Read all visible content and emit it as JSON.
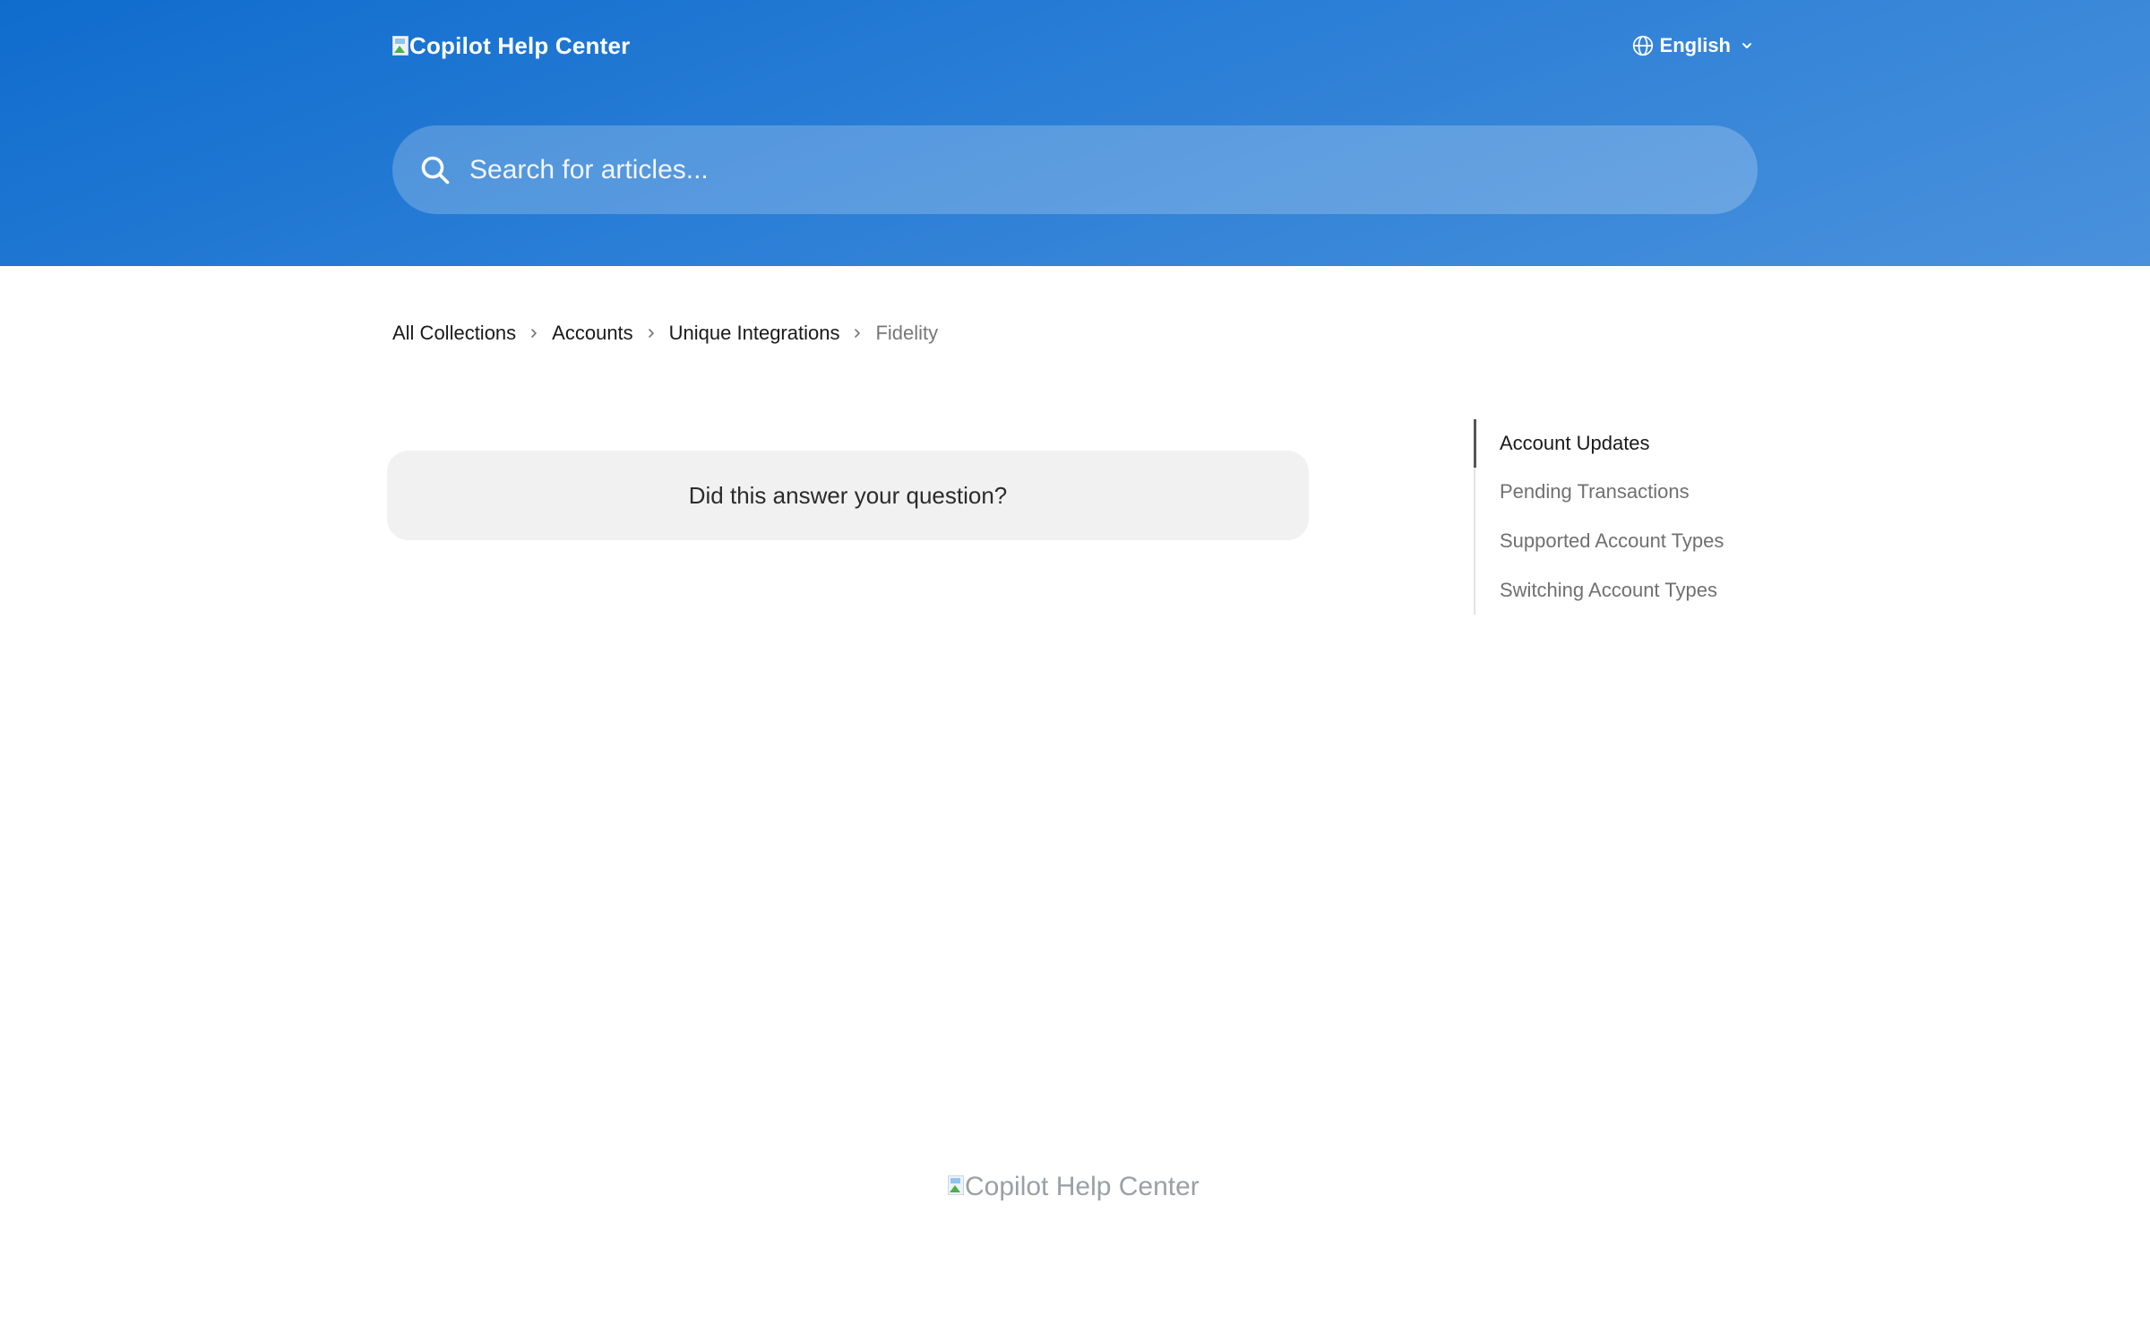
{
  "header": {
    "logo_alt": "Copilot Help Center",
    "language": {
      "label": "English",
      "icon": "globe-icon"
    },
    "search": {
      "placeholder": "Search for articles..."
    },
    "colors": {
      "gradient_start": "#0f6ccd",
      "gradient_end": "#4a91dc"
    }
  },
  "breadcrumb": {
    "items": [
      {
        "label": "All Collections"
      },
      {
        "label": "Accounts"
      },
      {
        "label": "Unique Integrations"
      },
      {
        "label": "Fidelity"
      }
    ]
  },
  "feedback": {
    "question": "Did this answer your question?"
  },
  "toc": {
    "items": [
      {
        "label": "Account Updates",
        "active": true
      },
      {
        "label": "Pending Transactions",
        "active": false
      },
      {
        "label": "Supported Account Types",
        "active": false
      },
      {
        "label": "Switching Account Types",
        "active": false
      }
    ]
  },
  "footer": {
    "logo_alt": "Copilot Help Center"
  }
}
